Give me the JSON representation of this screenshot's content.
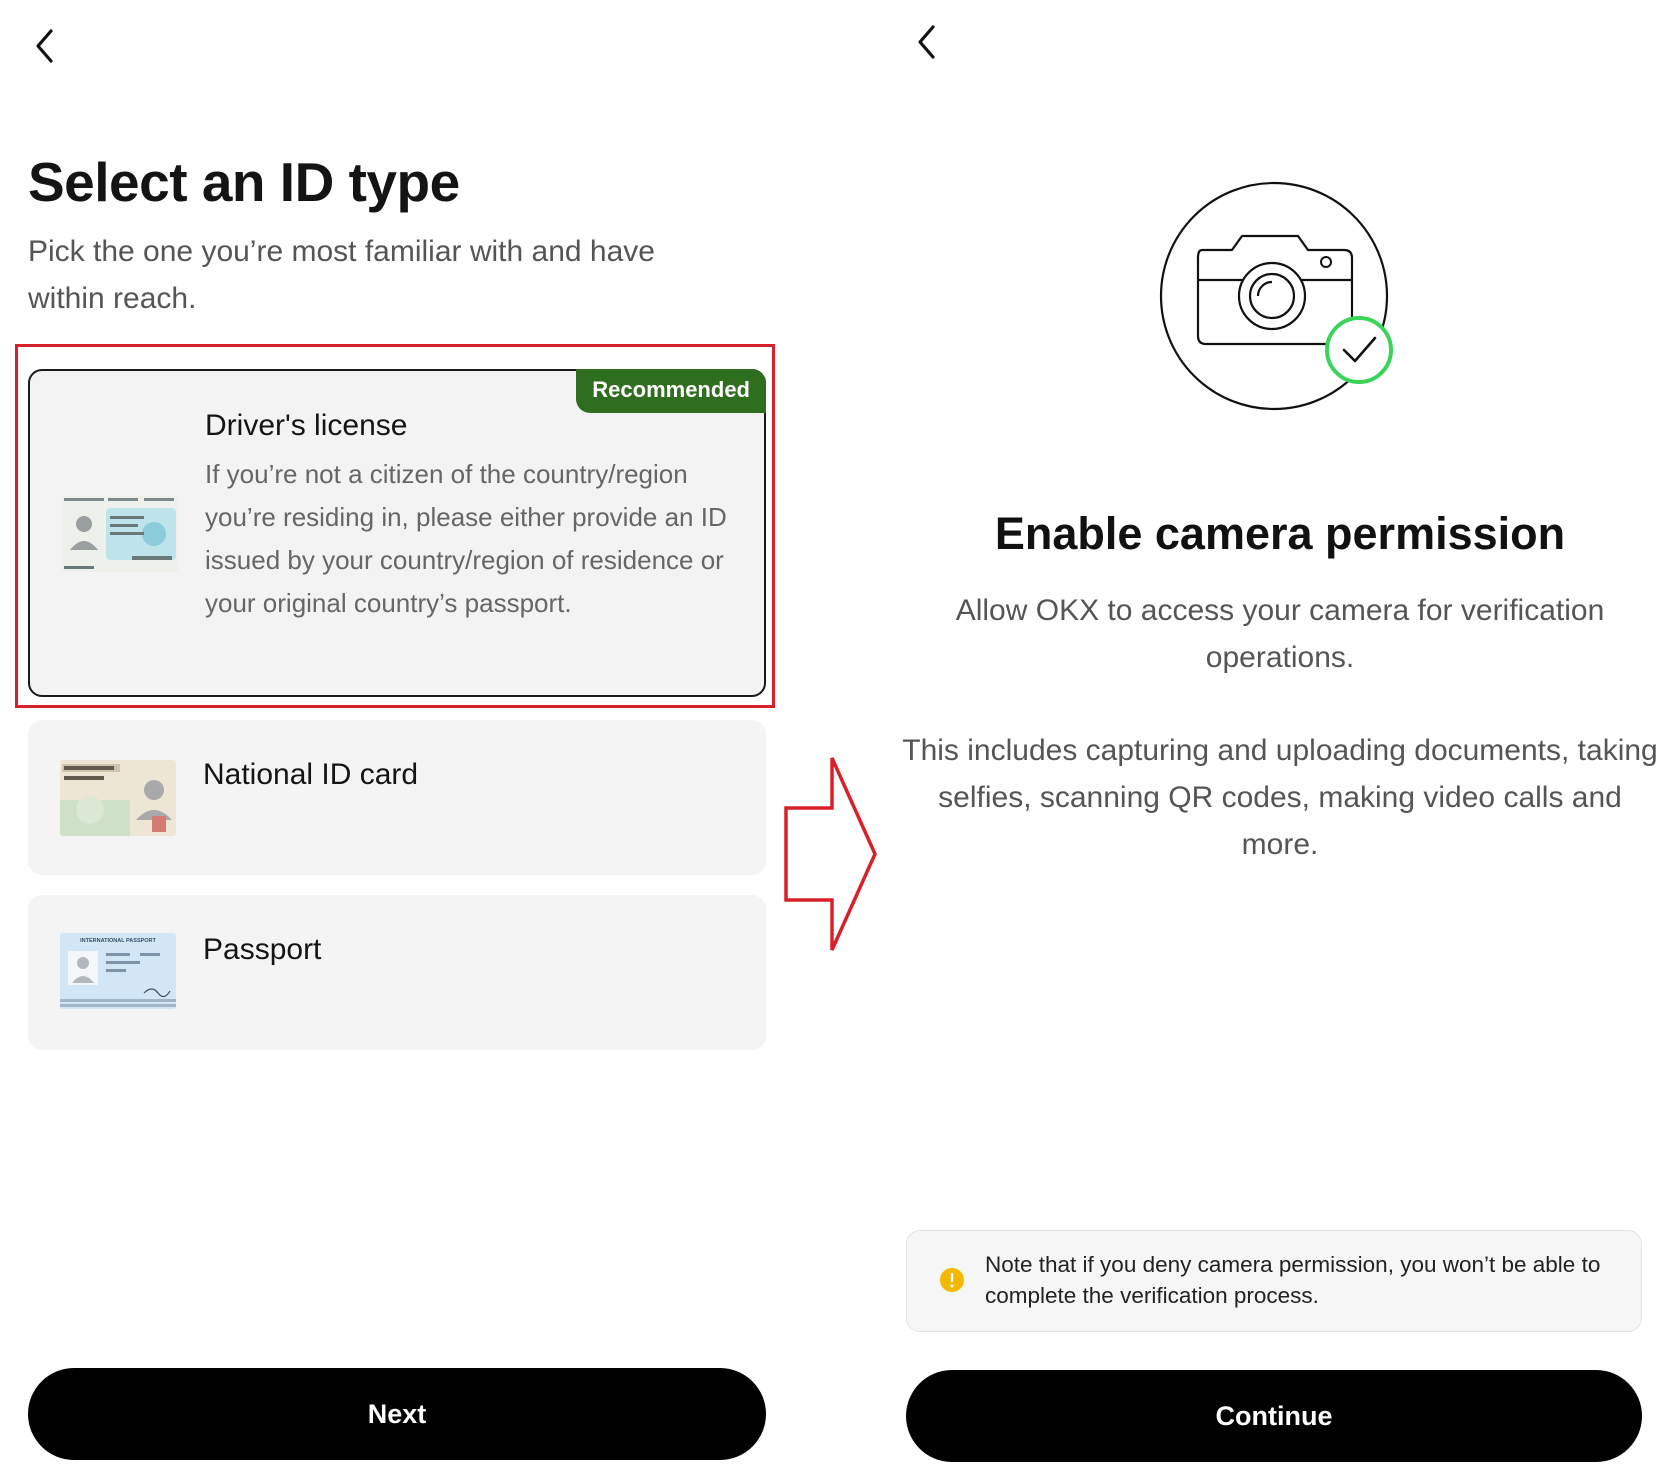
{
  "left_screen": {
    "title": "Select an ID type",
    "subtitle": "Pick the one you’re most familiar with and have within reach.",
    "options": [
      {
        "label": "Driver's license",
        "badge": "Recommended",
        "description": "If you’re not a citizen of the country/region you’re residing in, please either provide an ID issued by your country/region of residence or your original country’s passport.",
        "selected": true
      },
      {
        "label": "National ID card",
        "selected": false
      },
      {
        "label": "Passport",
        "selected": false,
        "thumb_text": "INTERNATIONAL PASSPORT"
      }
    ],
    "next_label": "Next"
  },
  "right_screen": {
    "title": "Enable camera permission",
    "paragraph1": "Allow OKX to access your camera for verification operations.",
    "paragraph2": "This includes capturing and uploading documents, taking selfies, scanning QR codes, making video calls and more.",
    "note": "Note that if you deny camera permission, you won’t be able to complete the verification process.",
    "continue_label": "Continue"
  },
  "icons": {
    "back": "chevron-left-icon",
    "camera": "camera-icon",
    "check": "check-icon",
    "warning": "warning-icon",
    "arrow": "arrow-right-icon"
  },
  "colors": {
    "highlight_border": "#d8202a",
    "badge_bg": "#2f6e1f",
    "check_ring": "#3bd45a",
    "warning": "#f5b800",
    "button_bg": "#000000"
  }
}
